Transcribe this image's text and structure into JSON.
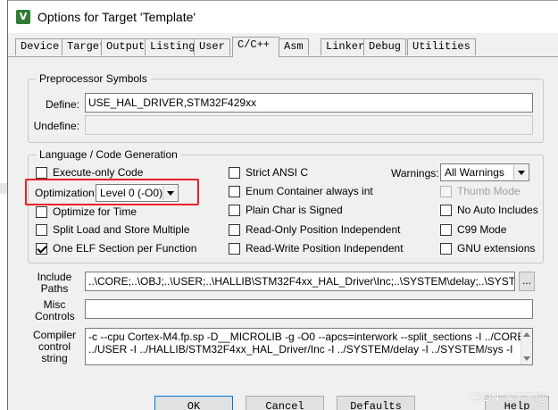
{
  "window": {
    "icon": "keil-uvision-icon",
    "title": "Options for Target 'Template'"
  },
  "tabs": [
    {
      "label": "Device",
      "active": false
    },
    {
      "label": "Target",
      "active": false
    },
    {
      "label": "Output",
      "active": false
    },
    {
      "label": "Listing",
      "active": false
    },
    {
      "label": "User",
      "active": false
    },
    {
      "label": "C/C++",
      "active": true
    },
    {
      "label": "Asm",
      "active": false
    },
    {
      "label": "Linker",
      "active": false
    },
    {
      "label": "Debug",
      "active": false
    },
    {
      "label": "Utilities",
      "active": false
    }
  ],
  "preprocessor": {
    "title": "Preprocessor Symbols",
    "define_label": "Define:",
    "define_value": "USE_HAL_DRIVER,STM32F429xx",
    "undefine_label": "Undefine:",
    "undefine_value": ""
  },
  "language": {
    "title": "Language / Code Generation",
    "execute_only": {
      "label": "Execute-only Code",
      "checked": false
    },
    "optimization_label": "Optimization:",
    "optimization_value": "Level 0 (-O0)",
    "optimize_time": {
      "label": "Optimize for Time",
      "checked": false
    },
    "split_load_store": {
      "label": "Split Load and Store Multiple",
      "checked": false
    },
    "one_elf_section": {
      "label": "One ELF Section per Function",
      "checked": true
    },
    "strict_ansi": {
      "label": "Strict ANSI C",
      "checked": false
    },
    "enum_container": {
      "label": "Enum Container always int",
      "checked": false
    },
    "plain_char_signed": {
      "label": "Plain Char is Signed",
      "checked": false
    },
    "readonly_pi": {
      "label": "Read-Only Position Independent",
      "checked": false
    },
    "readwrite_pi": {
      "label": "Read-Write Position Independent",
      "checked": false
    },
    "warnings_label": "Warnings:",
    "warnings_value": "All Warnings",
    "thumb_mode": {
      "label": "Thumb Mode",
      "checked": false,
      "disabled": true
    },
    "no_auto_includes": {
      "label": "No Auto Includes",
      "checked": false
    },
    "c99_mode": {
      "label": "C99 Mode",
      "checked": false
    },
    "gnu_extensions": {
      "label": "GNU extensions",
      "checked": false
    }
  },
  "include_paths": {
    "label_line1": "Include",
    "label_line2": "Paths",
    "value": "..\\CORE;..\\OBJ;..\\USER;..\\HALLIB\\STM32F4xx_HAL_Driver\\Inc;..\\SYSTEM\\delay;..\\SYSTEM\\sys",
    "browse": "..."
  },
  "misc_controls": {
    "label_line1": "Misc",
    "label_line2": "Controls",
    "value": ""
  },
  "compiler_string": {
    "label_line1": "Compiler",
    "label_line2": "control",
    "label_line3": "string",
    "line1": "-c --cpu Cortex-M4.fp.sp -D__MICROLIB -g -O0 --apcs=interwork --split_sections -I ../CORE -I ../OBJ -I",
    "line2": "../USER -I ../HALLIB/STM32F4xx_HAL_Driver/Inc -I ../SYSTEM/delay -I ../SYSTEM/sys -I"
  },
  "buttons": {
    "ok": "OK",
    "cancel": "Cancel",
    "defaults": "Defaults",
    "help": "Help"
  },
  "watermark": "CSDN @于于道",
  "colors": {
    "dialog_bg": "#f0f0f0",
    "highlight": "#e8202a"
  }
}
